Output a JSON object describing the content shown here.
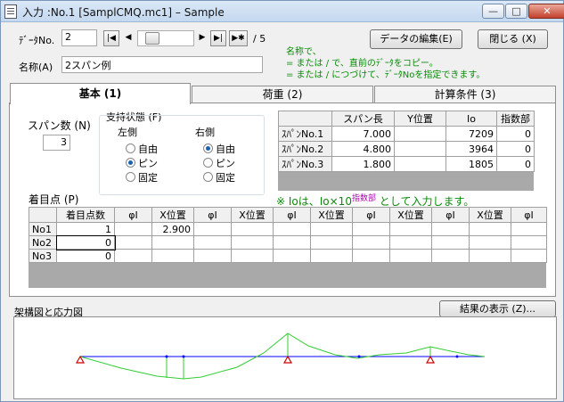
{
  "window": {
    "title": "入力 :No.1 [SamplCMQ.mc1] – Sample",
    "minimize_glyph": "—",
    "maximize_glyph": "□",
    "close_glyph": "✕"
  },
  "form": {
    "data_no_label": "ﾃﾞｰﾀNo.",
    "data_no_value": "2",
    "nav_first": "|◀",
    "nav_prev": "◀",
    "nav_next": "▶",
    "nav_last": "▶|",
    "nav_new": "▶✱",
    "total": "/ 5",
    "name_label": "名称(A)",
    "name_value": "2スパン例",
    "edit_button": "データの編集(E)",
    "close_button": "閉じる (X)",
    "hint_lines": [
      "名称で、",
      "= または / で、直前のﾃﾞｰﾀをコピー。",
      "= または / につづけて、ﾃﾞｰﾀNoを指定できます。"
    ]
  },
  "tabs": [
    "基本 (1)",
    "荷重 (2)",
    "計算条件 (3)"
  ],
  "basic": {
    "span_count_label": "スパン数 (N)",
    "span_count_value": "3",
    "support_label": "支持状態 (F)",
    "left_label": "左側",
    "right_label": "右側",
    "options": [
      "自由",
      "ピン",
      "固定"
    ],
    "left_selected": 1,
    "right_selected": 0
  },
  "span_table": {
    "headers": [
      "",
      "スパン長",
      "Y位置",
      "Io",
      "指数部"
    ],
    "rows": [
      [
        "ｽﾊﾟﾝNo.1",
        "7.000",
        "",
        "7209",
        "0"
      ],
      [
        "ｽﾊﾟﾝNo.2",
        "4.800",
        "",
        "3964",
        "0"
      ],
      [
        "ｽﾊﾟﾝNo.3",
        "1.800",
        "",
        "1805",
        "0"
      ]
    ]
  },
  "note": {
    "prefix": "※ Ioは、Io×10",
    "superscript": "指数部",
    "suffix": " として入力します。"
  },
  "point_table": {
    "label": "着目点 (P)",
    "headers": [
      "",
      "着目点数",
      "φI",
      "X位置",
      "φI",
      "X位置",
      "φI",
      "X位置",
      "φI",
      "X位置",
      "φI",
      "X位置",
      "φI"
    ],
    "rows": [
      [
        "No1",
        "1",
        "",
        "2.900",
        "",
        "",
        "",
        "",
        "",
        "",
        "",
        "",
        ""
      ],
      [
        "No2",
        "0",
        "",
        "",
        "",
        "",
        "",
        "",
        "",
        "",
        "",
        "",
        ""
      ],
      [
        "No3",
        "0",
        "",
        "",
        "",
        "",
        "",
        "",
        "",
        "",
        "",
        "",
        ""
      ]
    ]
  },
  "diagram": {
    "label": "架構図と応力図",
    "result_button": "結果の表示 (Z)...",
    "beam_color": "#0000ff",
    "moment_color": "#33cc33",
    "support_color": "#cc0000"
  }
}
